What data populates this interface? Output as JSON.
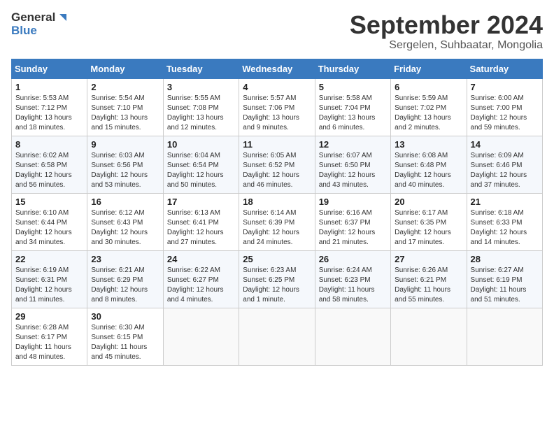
{
  "logo": {
    "line1": "General",
    "line2": "Blue"
  },
  "title": "September 2024",
  "subtitle": "Sergelen, Suhbaatar, Mongolia",
  "weekdays": [
    "Sunday",
    "Monday",
    "Tuesday",
    "Wednesday",
    "Thursday",
    "Friday",
    "Saturday"
  ],
  "weeks": [
    [
      {
        "day": "1",
        "sunrise": "5:53 AM",
        "sunset": "7:12 PM",
        "daylight": "13 hours and 18 minutes."
      },
      {
        "day": "2",
        "sunrise": "5:54 AM",
        "sunset": "7:10 PM",
        "daylight": "13 hours and 15 minutes."
      },
      {
        "day": "3",
        "sunrise": "5:55 AM",
        "sunset": "7:08 PM",
        "daylight": "13 hours and 12 minutes."
      },
      {
        "day": "4",
        "sunrise": "5:57 AM",
        "sunset": "7:06 PM",
        "daylight": "13 hours and 9 minutes."
      },
      {
        "day": "5",
        "sunrise": "5:58 AM",
        "sunset": "7:04 PM",
        "daylight": "13 hours and 6 minutes."
      },
      {
        "day": "6",
        "sunrise": "5:59 AM",
        "sunset": "7:02 PM",
        "daylight": "13 hours and 2 minutes."
      },
      {
        "day": "7",
        "sunrise": "6:00 AM",
        "sunset": "7:00 PM",
        "daylight": "12 hours and 59 minutes."
      }
    ],
    [
      {
        "day": "8",
        "sunrise": "6:02 AM",
        "sunset": "6:58 PM",
        "daylight": "12 hours and 56 minutes."
      },
      {
        "day": "9",
        "sunrise": "6:03 AM",
        "sunset": "6:56 PM",
        "daylight": "12 hours and 53 minutes."
      },
      {
        "day": "10",
        "sunrise": "6:04 AM",
        "sunset": "6:54 PM",
        "daylight": "12 hours and 50 minutes."
      },
      {
        "day": "11",
        "sunrise": "6:05 AM",
        "sunset": "6:52 PM",
        "daylight": "12 hours and 46 minutes."
      },
      {
        "day": "12",
        "sunrise": "6:07 AM",
        "sunset": "6:50 PM",
        "daylight": "12 hours and 43 minutes."
      },
      {
        "day": "13",
        "sunrise": "6:08 AM",
        "sunset": "6:48 PM",
        "daylight": "12 hours and 40 minutes."
      },
      {
        "day": "14",
        "sunrise": "6:09 AM",
        "sunset": "6:46 PM",
        "daylight": "12 hours and 37 minutes."
      }
    ],
    [
      {
        "day": "15",
        "sunrise": "6:10 AM",
        "sunset": "6:44 PM",
        "daylight": "12 hours and 34 minutes."
      },
      {
        "day": "16",
        "sunrise": "6:12 AM",
        "sunset": "6:43 PM",
        "daylight": "12 hours and 30 minutes."
      },
      {
        "day": "17",
        "sunrise": "6:13 AM",
        "sunset": "6:41 PM",
        "daylight": "12 hours and 27 minutes."
      },
      {
        "day": "18",
        "sunrise": "6:14 AM",
        "sunset": "6:39 PM",
        "daylight": "12 hours and 24 minutes."
      },
      {
        "day": "19",
        "sunrise": "6:16 AM",
        "sunset": "6:37 PM",
        "daylight": "12 hours and 21 minutes."
      },
      {
        "day": "20",
        "sunrise": "6:17 AM",
        "sunset": "6:35 PM",
        "daylight": "12 hours and 17 minutes."
      },
      {
        "day": "21",
        "sunrise": "6:18 AM",
        "sunset": "6:33 PM",
        "daylight": "12 hours and 14 minutes."
      }
    ],
    [
      {
        "day": "22",
        "sunrise": "6:19 AM",
        "sunset": "6:31 PM",
        "daylight": "12 hours and 11 minutes."
      },
      {
        "day": "23",
        "sunrise": "6:21 AM",
        "sunset": "6:29 PM",
        "daylight": "12 hours and 8 minutes."
      },
      {
        "day": "24",
        "sunrise": "6:22 AM",
        "sunset": "6:27 PM",
        "daylight": "12 hours and 4 minutes."
      },
      {
        "day": "25",
        "sunrise": "6:23 AM",
        "sunset": "6:25 PM",
        "daylight": "12 hours and 1 minute."
      },
      {
        "day": "26",
        "sunrise": "6:24 AM",
        "sunset": "6:23 PM",
        "daylight": "11 hours and 58 minutes."
      },
      {
        "day": "27",
        "sunrise": "6:26 AM",
        "sunset": "6:21 PM",
        "daylight": "11 hours and 55 minutes."
      },
      {
        "day": "28",
        "sunrise": "6:27 AM",
        "sunset": "6:19 PM",
        "daylight": "11 hours and 51 minutes."
      }
    ],
    [
      {
        "day": "29",
        "sunrise": "6:28 AM",
        "sunset": "6:17 PM",
        "daylight": "11 hours and 48 minutes."
      },
      {
        "day": "30",
        "sunrise": "6:30 AM",
        "sunset": "6:15 PM",
        "daylight": "11 hours and 45 minutes."
      },
      null,
      null,
      null,
      null,
      null
    ]
  ]
}
